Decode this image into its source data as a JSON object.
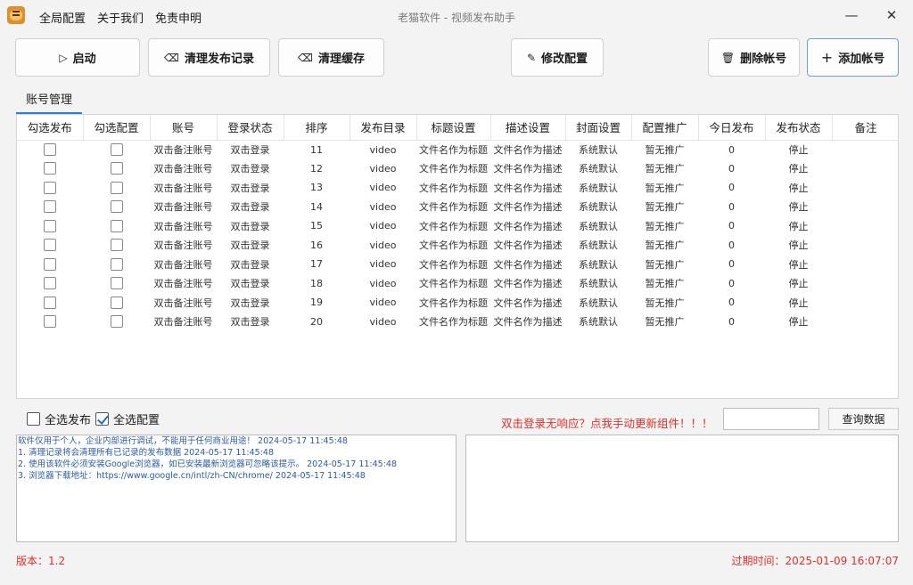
{
  "menu": [
    "全局配置",
    "关于我们",
    "免责申明"
  ],
  "window_title": "老猫软件 - 视频发布助手",
  "toolbar": {
    "start": {
      "icon": "play-icon",
      "label": "启动"
    },
    "clear_records": {
      "icon": "eraser-icon",
      "label": "清理发布记录"
    },
    "clear_cache": {
      "icon": "eraser-icon",
      "label": "清理缓存"
    },
    "edit_config": {
      "icon": "pencil-icon",
      "label": "修改配置"
    },
    "delete_account": {
      "icon": "trash-icon",
      "label": "删除帐号"
    },
    "add_account": {
      "icon": "plus-icon",
      "label": "添加帐号"
    }
  },
  "tab_label": "账号管理",
  "grid": {
    "columns": [
      "勾选发布",
      "勾选配置",
      "账号",
      "登录状态",
      "排序",
      "发布目录",
      "标题设置",
      "描述设置",
      "封面设置",
      "配置推广",
      "今日发布",
      "发布状态",
      "备注"
    ],
    "rows": [
      {
        "account": "双击备注账号",
        "login": "双击登录",
        "order": "11",
        "dir": "video",
        "title": "文件名作为标题",
        "desc": "文件名作为描述",
        "cover": "系统默认",
        "promo": "暂无推广",
        "today": "0",
        "status": "停止",
        "note": ""
      },
      {
        "account": "双击备注账号",
        "login": "双击登录",
        "order": "12",
        "dir": "video",
        "title": "文件名作为标题",
        "desc": "文件名作为描述",
        "cover": "系统默认",
        "promo": "暂无推广",
        "today": "0",
        "status": "停止",
        "note": ""
      },
      {
        "account": "双击备注账号",
        "login": "双击登录",
        "order": "13",
        "dir": "video",
        "title": "文件名作为标题",
        "desc": "文件名作为描述",
        "cover": "系统默认",
        "promo": "暂无推广",
        "today": "0",
        "status": "停止",
        "note": ""
      },
      {
        "account": "双击备注账号",
        "login": "双击登录",
        "order": "14",
        "dir": "video",
        "title": "文件名作为标题",
        "desc": "文件名作为描述",
        "cover": "系统默认",
        "promo": "暂无推广",
        "today": "0",
        "status": "停止",
        "note": ""
      },
      {
        "account": "双击备注账号",
        "login": "双击登录",
        "order": "15",
        "dir": "video",
        "title": "文件名作为标题",
        "desc": "文件名作为描述",
        "cover": "系统默认",
        "promo": "暂无推广",
        "today": "0",
        "status": "停止",
        "note": ""
      },
      {
        "account": "双击备注账号",
        "login": "双击登录",
        "order": "16",
        "dir": "video",
        "title": "文件名作为标题",
        "desc": "文件名作为描述",
        "cover": "系统默认",
        "promo": "暂无推广",
        "today": "0",
        "status": "停止",
        "note": ""
      },
      {
        "account": "双击备注账号",
        "login": "双击登录",
        "order": "17",
        "dir": "video",
        "title": "文件名作为标题",
        "desc": "文件名作为描述",
        "cover": "系统默认",
        "promo": "暂无推广",
        "today": "0",
        "status": "停止",
        "note": ""
      },
      {
        "account": "双击备注账号",
        "login": "双击登录",
        "order": "18",
        "dir": "video",
        "title": "文件名作为标题",
        "desc": "文件名作为描述",
        "cover": "系统默认",
        "promo": "暂无推广",
        "today": "0",
        "status": "停止",
        "note": ""
      },
      {
        "account": "双击备注账号",
        "login": "双击登录",
        "order": "19",
        "dir": "video",
        "title": "文件名作为标题",
        "desc": "文件名作为描述",
        "cover": "系统默认",
        "promo": "暂无推广",
        "today": "0",
        "status": "停止",
        "note": ""
      },
      {
        "account": "双击备注账号",
        "login": "双击登录",
        "order": "20",
        "dir": "video",
        "title": "文件名作为标题",
        "desc": "文件名作为描述",
        "cover": "系统默认",
        "promo": "暂无推广",
        "today": "0",
        "status": "停止",
        "note": ""
      }
    ]
  },
  "bottom": {
    "select_all_publish": {
      "label": "全选发布",
      "checked": false
    },
    "select_all_config": {
      "label": "全选配置",
      "checked": true
    },
    "warning": "双击登录无响应？点我手动更新组件！！！",
    "query_value": "",
    "query_button": "查询数据"
  },
  "log_lines": [
    "软件仅用于个人，企业内部进行调试，不能用于任何商业用途！ 2024-05-17 11:45:48",
    "1. 清理记录将会清理所有已记录的发布数据 2024-05-17 11:45:48",
    "2. 使用该软件必须安装Google浏览器，如已安装最新浏览器可忽略该提示。 2024-05-17 11:45:48",
    "3. 浏览器下载地址：https://www.google.cn/intl/zh-CN/chrome/ 2024-05-17 11:45:48"
  ],
  "footer": {
    "version": "版本：1.2",
    "expiry": "过期时间：2025-01-09 16:07:07"
  },
  "colors": {
    "accent": "#2d7fd3",
    "warning": "#e0302a",
    "log_text": "#2a5aa8"
  }
}
